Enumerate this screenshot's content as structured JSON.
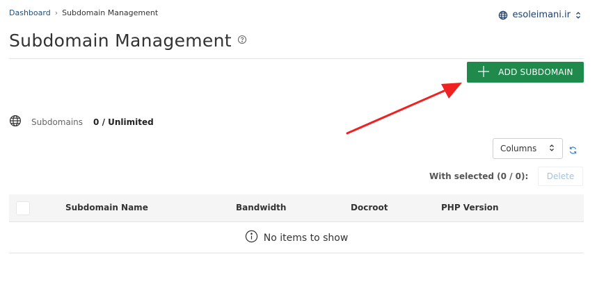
{
  "breadcrumb": {
    "home": "Dashboard",
    "separator": "›",
    "current": "Subdomain Management"
  },
  "domain_selector": {
    "value": "esoleimani.ir",
    "icon": "globe-icon"
  },
  "page": {
    "title": "Subdomain Management",
    "help_icon": "help-circle-icon"
  },
  "toolbar": {
    "add_label": "ADD SUBDOMAIN",
    "add_icon": "plus-icon"
  },
  "stats": {
    "label": "Subdomains",
    "value": "0 / Unlimited",
    "icon": "globe-icon"
  },
  "controls": {
    "columns_label": "Columns",
    "refresh_icon": "refresh-icon"
  },
  "selection": {
    "label": "With selected (0 / 0):",
    "delete_label": "Delete"
  },
  "table": {
    "columns": [
      "Subdomain Name",
      "Bandwidth",
      "Docroot",
      "PHP Version"
    ],
    "empty_message": "No items to show",
    "empty_icon": "info-circle-icon"
  },
  "colors": {
    "accent": "#1f8a4c",
    "annotation_arrow": "#f02121",
    "link": "#1d4f7a"
  }
}
